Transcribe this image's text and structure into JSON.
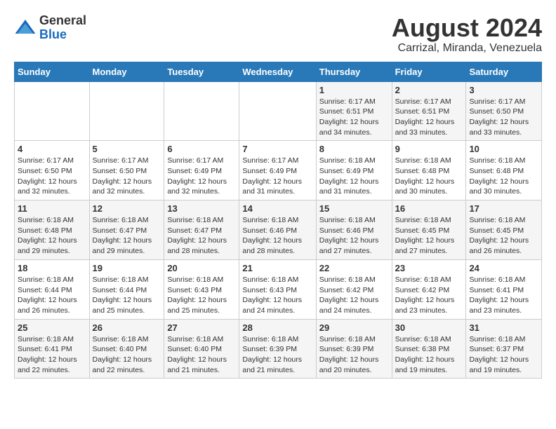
{
  "logo": {
    "general": "General",
    "blue": "Blue"
  },
  "title": {
    "month_year": "August 2024",
    "location": "Carrizal, Miranda, Venezuela"
  },
  "weekdays": [
    "Sunday",
    "Monday",
    "Tuesday",
    "Wednesday",
    "Thursday",
    "Friday",
    "Saturday"
  ],
  "weeks": [
    [
      {
        "day": "",
        "info": ""
      },
      {
        "day": "",
        "info": ""
      },
      {
        "day": "",
        "info": ""
      },
      {
        "day": "",
        "info": ""
      },
      {
        "day": "1",
        "info": "Sunrise: 6:17 AM\nSunset: 6:51 PM\nDaylight: 12 hours\nand 34 minutes."
      },
      {
        "day": "2",
        "info": "Sunrise: 6:17 AM\nSunset: 6:51 PM\nDaylight: 12 hours\nand 33 minutes."
      },
      {
        "day": "3",
        "info": "Sunrise: 6:17 AM\nSunset: 6:50 PM\nDaylight: 12 hours\nand 33 minutes."
      }
    ],
    [
      {
        "day": "4",
        "info": "Sunrise: 6:17 AM\nSunset: 6:50 PM\nDaylight: 12 hours\nand 32 minutes."
      },
      {
        "day": "5",
        "info": "Sunrise: 6:17 AM\nSunset: 6:50 PM\nDaylight: 12 hours\nand 32 minutes."
      },
      {
        "day": "6",
        "info": "Sunrise: 6:17 AM\nSunset: 6:49 PM\nDaylight: 12 hours\nand 32 minutes."
      },
      {
        "day": "7",
        "info": "Sunrise: 6:17 AM\nSunset: 6:49 PM\nDaylight: 12 hours\nand 31 minutes."
      },
      {
        "day": "8",
        "info": "Sunrise: 6:18 AM\nSunset: 6:49 PM\nDaylight: 12 hours\nand 31 minutes."
      },
      {
        "day": "9",
        "info": "Sunrise: 6:18 AM\nSunset: 6:48 PM\nDaylight: 12 hours\nand 30 minutes."
      },
      {
        "day": "10",
        "info": "Sunrise: 6:18 AM\nSunset: 6:48 PM\nDaylight: 12 hours\nand 30 minutes."
      }
    ],
    [
      {
        "day": "11",
        "info": "Sunrise: 6:18 AM\nSunset: 6:48 PM\nDaylight: 12 hours\nand 29 minutes."
      },
      {
        "day": "12",
        "info": "Sunrise: 6:18 AM\nSunset: 6:47 PM\nDaylight: 12 hours\nand 29 minutes."
      },
      {
        "day": "13",
        "info": "Sunrise: 6:18 AM\nSunset: 6:47 PM\nDaylight: 12 hours\nand 28 minutes."
      },
      {
        "day": "14",
        "info": "Sunrise: 6:18 AM\nSunset: 6:46 PM\nDaylight: 12 hours\nand 28 minutes."
      },
      {
        "day": "15",
        "info": "Sunrise: 6:18 AM\nSunset: 6:46 PM\nDaylight: 12 hours\nand 27 minutes."
      },
      {
        "day": "16",
        "info": "Sunrise: 6:18 AM\nSunset: 6:45 PM\nDaylight: 12 hours\nand 27 minutes."
      },
      {
        "day": "17",
        "info": "Sunrise: 6:18 AM\nSunset: 6:45 PM\nDaylight: 12 hours\nand 26 minutes."
      }
    ],
    [
      {
        "day": "18",
        "info": "Sunrise: 6:18 AM\nSunset: 6:44 PM\nDaylight: 12 hours\nand 26 minutes."
      },
      {
        "day": "19",
        "info": "Sunrise: 6:18 AM\nSunset: 6:44 PM\nDaylight: 12 hours\nand 25 minutes."
      },
      {
        "day": "20",
        "info": "Sunrise: 6:18 AM\nSunset: 6:43 PM\nDaylight: 12 hours\nand 25 minutes."
      },
      {
        "day": "21",
        "info": "Sunrise: 6:18 AM\nSunset: 6:43 PM\nDaylight: 12 hours\nand 24 minutes."
      },
      {
        "day": "22",
        "info": "Sunrise: 6:18 AM\nSunset: 6:42 PM\nDaylight: 12 hours\nand 24 minutes."
      },
      {
        "day": "23",
        "info": "Sunrise: 6:18 AM\nSunset: 6:42 PM\nDaylight: 12 hours\nand 23 minutes."
      },
      {
        "day": "24",
        "info": "Sunrise: 6:18 AM\nSunset: 6:41 PM\nDaylight: 12 hours\nand 23 minutes."
      }
    ],
    [
      {
        "day": "25",
        "info": "Sunrise: 6:18 AM\nSunset: 6:41 PM\nDaylight: 12 hours\nand 22 minutes."
      },
      {
        "day": "26",
        "info": "Sunrise: 6:18 AM\nSunset: 6:40 PM\nDaylight: 12 hours\nand 22 minutes."
      },
      {
        "day": "27",
        "info": "Sunrise: 6:18 AM\nSunset: 6:40 PM\nDaylight: 12 hours\nand 21 minutes."
      },
      {
        "day": "28",
        "info": "Sunrise: 6:18 AM\nSunset: 6:39 PM\nDaylight: 12 hours\nand 21 minutes."
      },
      {
        "day": "29",
        "info": "Sunrise: 6:18 AM\nSunset: 6:39 PM\nDaylight: 12 hours\nand 20 minutes."
      },
      {
        "day": "30",
        "info": "Sunrise: 6:18 AM\nSunset: 6:38 PM\nDaylight: 12 hours\nand 19 minutes."
      },
      {
        "day": "31",
        "info": "Sunrise: 6:18 AM\nSunset: 6:37 PM\nDaylight: 12 hours\nand 19 minutes."
      }
    ]
  ]
}
